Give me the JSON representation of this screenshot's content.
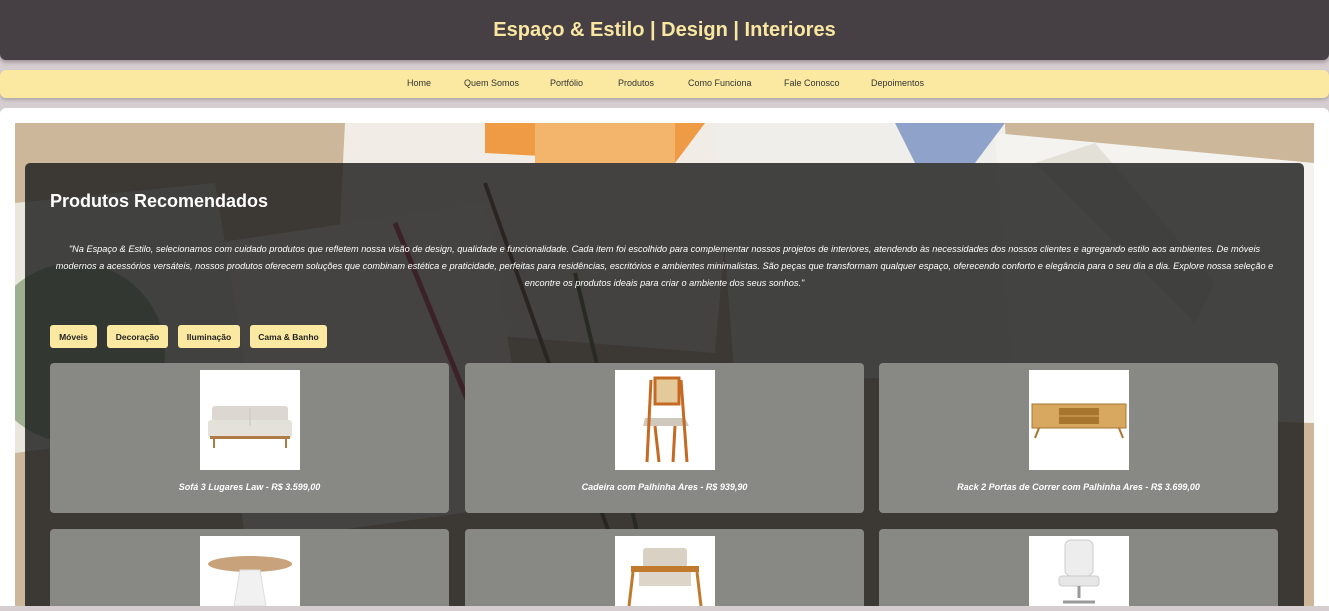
{
  "header": {
    "title": "Espaço & Estilo | Design | Interiores"
  },
  "nav": {
    "items": [
      "Home",
      "Quem Somos",
      "Portfólio",
      "Produtos",
      "Como Funciona",
      "Fale Conosco",
      "Depoimentos"
    ]
  },
  "section": {
    "title": "Produtos Recomendados",
    "intro": "\"Na Espaço & Estilo, selecionamos com cuidado produtos que refletem nossa visão de design, qualidade e funcionalidade. Cada item foi escolhido para complementar nossos projetos de interiores, atendendo às necessidades dos nossos clientes e agregando estilo aos ambientes. De móveis modernos a acessórios versáteis, nossos produtos oferecem soluções que combinam estética e praticidade, perfeitas para residências, escritórios e ambientes minimalistas. São peças que transformam qualquer espaço, oferecendo conforto e elegância para o seu dia a dia. Explore nossa seleção e encontre os produtos ideais para criar o ambiente dos seus sonhos.\""
  },
  "filters": [
    "Móveis",
    "Decoração",
    "Iluminação",
    "Cama & Banho"
  ],
  "products": [
    {
      "caption": "Sofá 3 Lugares Law - R$ 3.599,00",
      "icon": "sofa-icon"
    },
    {
      "caption": "Cadeira com Palhinha Ares - R$ 939,90",
      "icon": "chair-icon"
    },
    {
      "caption": "Rack 2 Portas de Correr com Palhinha Ares - R$ 3.699,00",
      "icon": "tv-rack-icon"
    },
    {
      "caption": "",
      "icon": "round-table-icon"
    },
    {
      "caption": "",
      "icon": "armchair-icon"
    },
    {
      "caption": "",
      "icon": "office-chair-icon"
    }
  ],
  "colors": {
    "header_bg": "#464045",
    "accent": "#fbe9a1",
    "title": "#f9e7a1",
    "card_bg": "#888885"
  }
}
